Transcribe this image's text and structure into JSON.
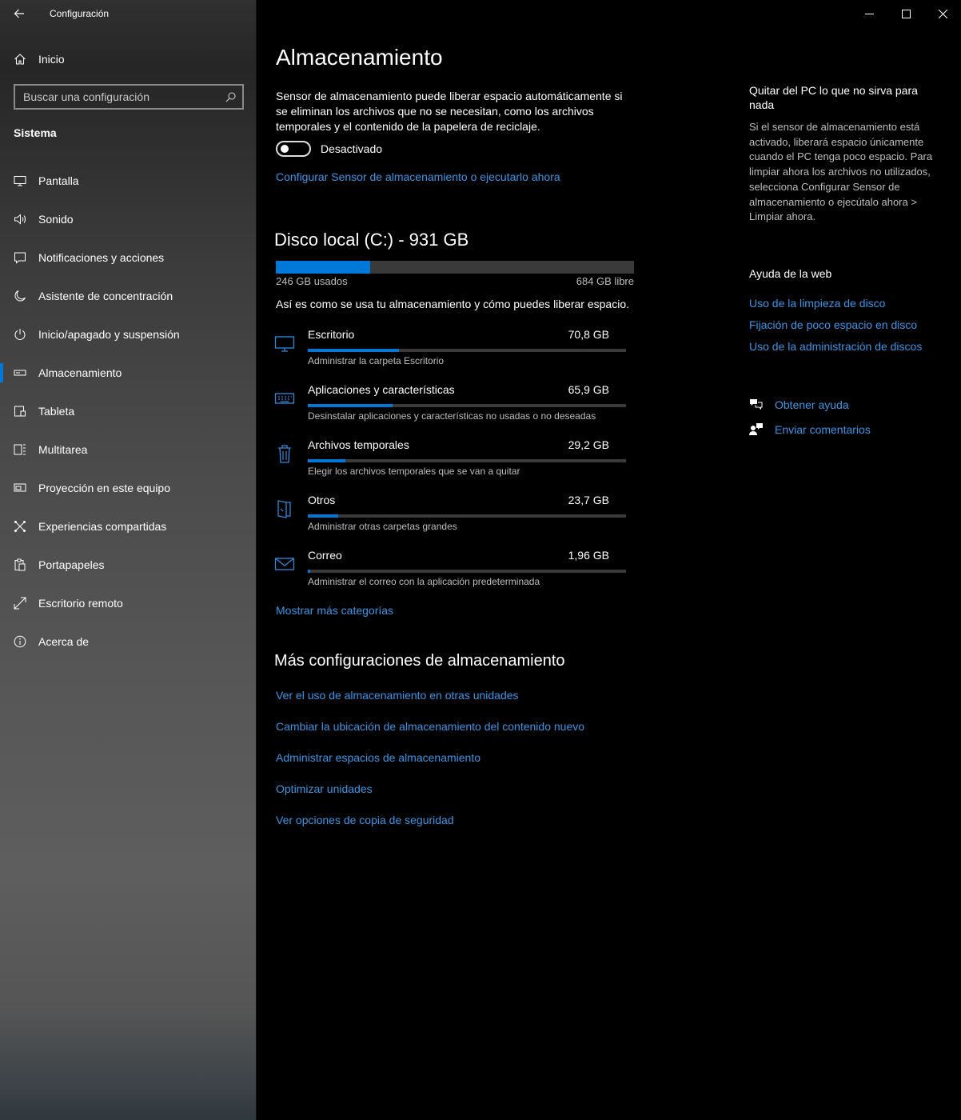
{
  "window": {
    "title": "Configuración",
    "accent": "#0078d7",
    "link_color": "#3796e8"
  },
  "sidebar": {
    "home_label": "Inicio",
    "search_placeholder": "Buscar una configuración",
    "section_label": "Sistema",
    "items": [
      {
        "label": "Pantalla",
        "icon": "display-icon"
      },
      {
        "label": "Sonido",
        "icon": "speaker-icon"
      },
      {
        "label": "Notificaciones y acciones",
        "icon": "notification-icon"
      },
      {
        "label": "Asistente de concentración",
        "icon": "moon-icon"
      },
      {
        "label": "Inicio/apagado y suspensión",
        "icon": "power-icon"
      },
      {
        "label": "Almacenamiento",
        "icon": "storage-icon",
        "selected": true
      },
      {
        "label": "Tableta",
        "icon": "tablet-icon"
      },
      {
        "label": "Multitarea",
        "icon": "multitask-icon"
      },
      {
        "label": "Proyección en este equipo",
        "icon": "projection-icon"
      },
      {
        "label": "Experiencias compartidas",
        "icon": "shared-icon"
      },
      {
        "label": "Portapapeles",
        "icon": "clipboard-icon"
      },
      {
        "label": "Escritorio remoto",
        "icon": "remote-icon"
      },
      {
        "label": "Acerca de",
        "icon": "info-icon"
      }
    ]
  },
  "main": {
    "title": "Almacenamiento",
    "sense_description": "Sensor de almacenamiento puede liberar espacio automáticamente si se eliminan los archivos que no se necesitan, como los archivos temporales y el contenido de la papelera de reciclaje.",
    "toggle_label": "Desactivado",
    "toggle_on": false,
    "configure_link": "Configurar Sensor de almacenamiento o ejecutarlo ahora",
    "disk": {
      "title": "Disco local (C:) - 931 GB",
      "used_label": "246 GB usados",
      "free_label": "684 GB libre",
      "used_fraction": 0.264
    },
    "usage_note": "Así es como se usa tu almacenamiento y cómo puedes liberar espacio.",
    "categories": [
      {
        "name": "Escritorio",
        "size": "70,8 GB",
        "desc": "Administrar la carpeta Escritorio",
        "fraction": 0.287,
        "icon": "monitor-icon"
      },
      {
        "name": "Aplicaciones y características",
        "size": "65,9 GB",
        "desc": "Desinstalar aplicaciones y características no usadas o no deseadas",
        "fraction": 0.267,
        "icon": "keyboard-icon"
      },
      {
        "name": "Archivos temporales",
        "size": "29,2 GB",
        "desc": "Elegir los archivos temporales que se van a quitar",
        "fraction": 0.118,
        "icon": "trash-icon"
      },
      {
        "name": "Otros",
        "size": "23,7 GB",
        "desc": "Administrar otras carpetas grandes",
        "fraction": 0.096,
        "icon": "folder-icon"
      },
      {
        "name": "Correo",
        "size": "1,96 GB",
        "desc": "Administrar el correo con la aplicación predeterminada",
        "fraction": 0.008,
        "icon": "mail-icon"
      }
    ],
    "more_categories_link": "Mostrar más categorías",
    "more_title": "Más configuraciones de almacenamiento",
    "more_links": [
      "Ver el uso de almacenamiento en otras unidades",
      "Cambiar la ubicación de almacenamiento del contenido nuevo",
      "Administrar espacios de almacenamiento",
      "Optimizar unidades",
      "Ver opciones de copia de seguridad"
    ]
  },
  "right_panel": {
    "title": "Quitar del PC lo que no sirva para nada",
    "body": "Si el sensor de almacenamiento está activado, liberará espacio únicamente cuando el PC tenga poco espacio. Para limpiar ahora los archivos no utilizados, selecciona Configurar Sensor de almacenamiento o ejecútalo ahora > Limpiar ahora.",
    "help_title": "Ayuda de la web",
    "help_links": [
      "Uso de la limpieza de disco",
      "Fijación de poco espacio en disco",
      "Uso de la administración de discos"
    ],
    "get_help": "Obtener ayuda",
    "send_feedback": "Enviar comentarios"
  }
}
